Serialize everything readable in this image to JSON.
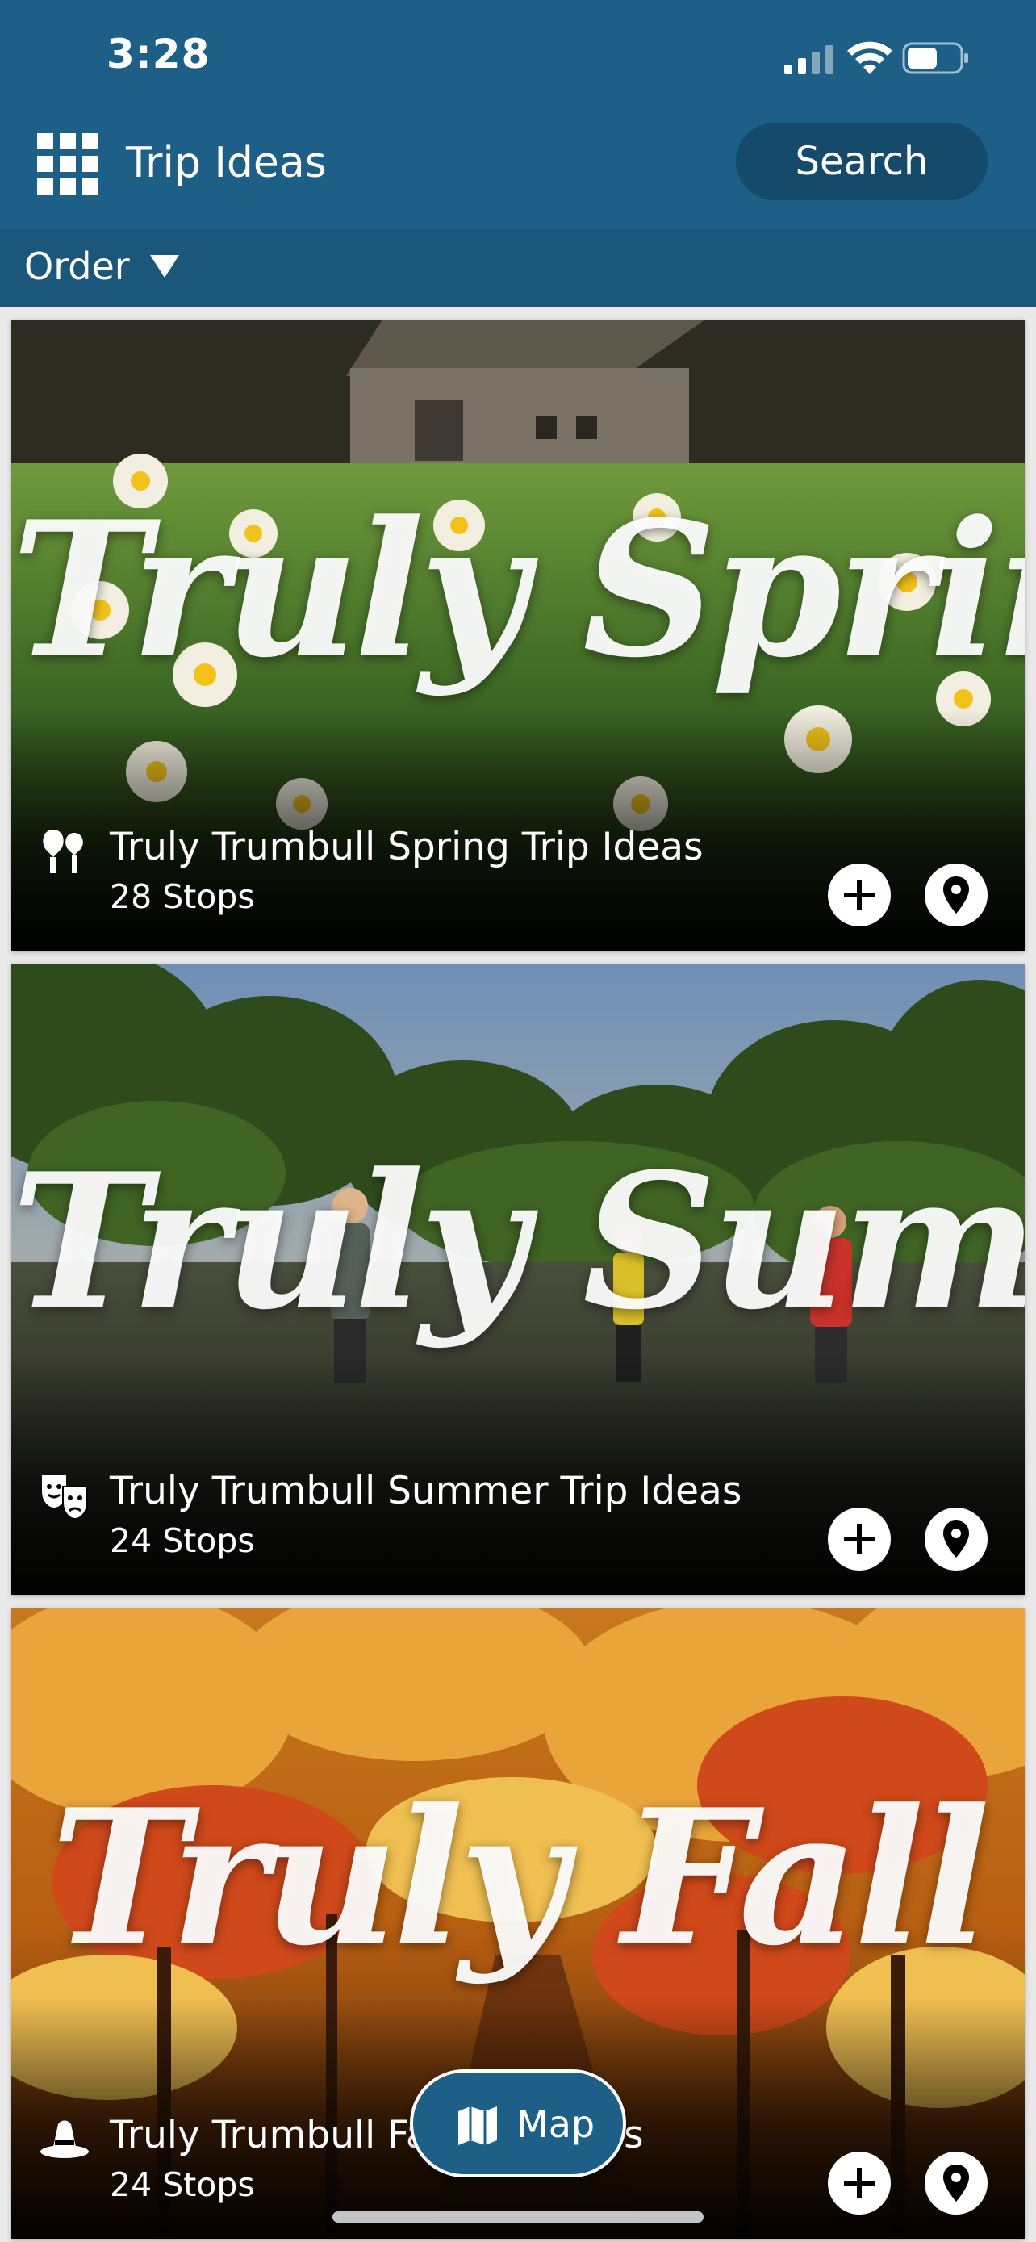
{
  "status_bar": {
    "time": "3:28",
    "signal_icon": "cellular-signal-icon",
    "wifi_icon": "wifi-icon",
    "battery_icon": "battery-icon"
  },
  "header": {
    "menu_icon": "grid-icon",
    "title": "Trip Ideas",
    "search_label": "Search"
  },
  "order_bar": {
    "label": "Order",
    "caret_icon": "caret-down-icon"
  },
  "cards": [
    {
      "hero_text": "Truly Spring",
      "title": "Truly Trumbull Spring Trip Ideas",
      "stops": "28 Stops",
      "category_icon": "attractions-icon",
      "add_icon": "plus-icon",
      "pin_icon": "location-pin-icon"
    },
    {
      "hero_text": "Truly Summer",
      "title": "Truly Trumbull Summer Trip Ideas",
      "stops": "24 Stops",
      "category_icon": "theater-masks-icon",
      "add_icon": "plus-icon",
      "pin_icon": "location-pin-icon"
    },
    {
      "hero_text": "Truly Fall",
      "title": "Truly Trumbull Fall Trip Ideas",
      "stops": "24 Stops",
      "category_icon": "campbell-hat-icon",
      "add_icon": "plus-icon",
      "pin_icon": "location-pin-icon"
    }
  ],
  "map_button": {
    "label": "Map",
    "icon": "map-icon"
  },
  "colors": {
    "header": "#1d5f87",
    "order_bar": "#1a577b",
    "search_button": "#164a6b",
    "card_background": "#000000"
  }
}
